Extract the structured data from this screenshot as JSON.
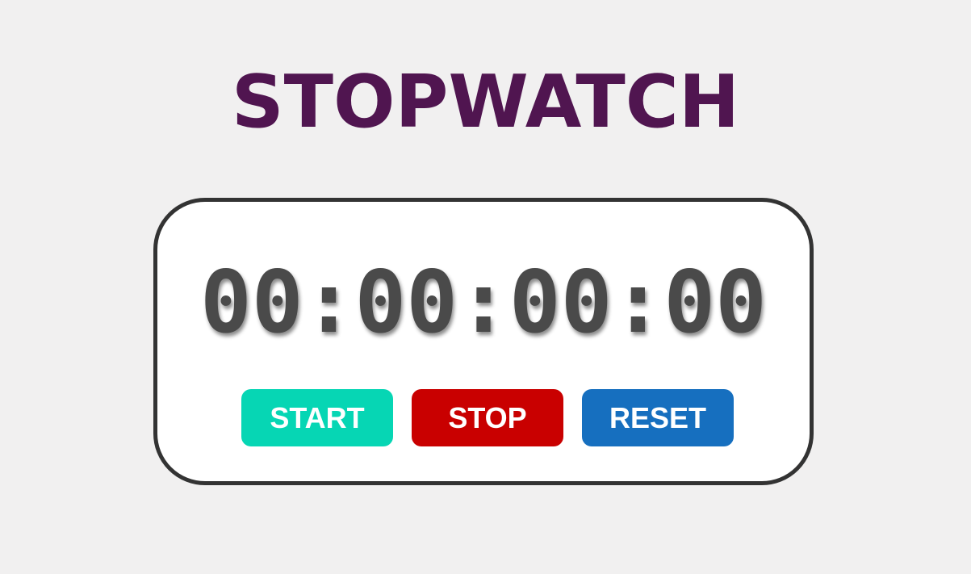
{
  "header": {
    "title": "STOPWATCH"
  },
  "stopwatch": {
    "display": "00:00:00:00",
    "buttons": {
      "start_label": "START",
      "stop_label": "STOP",
      "reset_label": "RESET"
    }
  },
  "colors": {
    "title": "#501550",
    "start": "#06d6b4",
    "stop": "#c90000",
    "reset": "#166fbf",
    "background": "#f1f0f0"
  }
}
